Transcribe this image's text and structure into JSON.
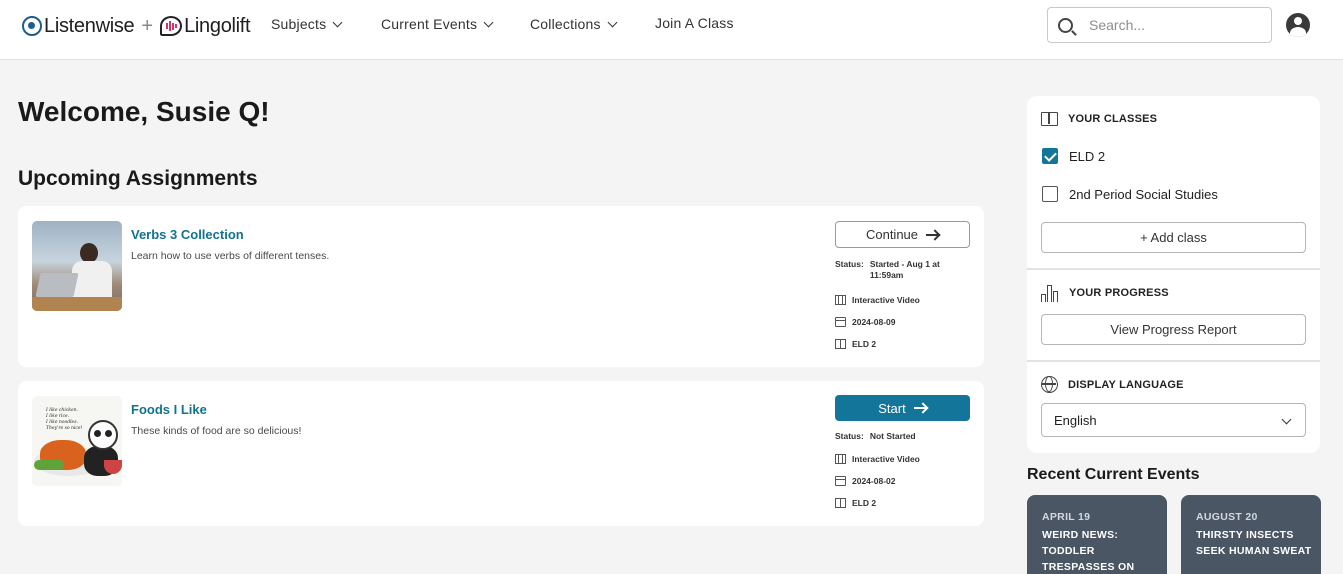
{
  "header": {
    "logo_primary": "Listenwise",
    "logo_plus": "+",
    "logo_secondary": "Lingolift",
    "nav": [
      {
        "label": "Subjects"
      },
      {
        "label": "Current Events"
      },
      {
        "label": "Collections"
      },
      {
        "label": "Join A Class"
      }
    ],
    "search_placeholder": "Search..."
  },
  "main": {
    "welcome": "Welcome, Susie Q!",
    "section_title": "Upcoming Assignments",
    "assignments": [
      {
        "title": "Verbs 3 Collection",
        "description": "Learn how to use verbs of different tenses.",
        "button": "Continue",
        "status_label": "Status:",
        "status_value": "Started - Aug 1 at 11:59am",
        "type": "Interactive Video",
        "date": "2024-08-09",
        "class": "ELD 2"
      },
      {
        "title": "Foods I Like",
        "description": "These kinds of food are so delicious!",
        "button": "Start",
        "status_label": "Status:",
        "status_value": "Not Started",
        "type": "Interactive Video",
        "date": "2024-08-02",
        "class": "ELD 2",
        "thumb_text": [
          "I like chicken.",
          "I like rice.",
          "I like noodles.",
          "They're so nice!"
        ]
      }
    ]
  },
  "sidebar": {
    "classes_heading": "YOUR CLASSES",
    "classes": [
      {
        "label": "ELD 2",
        "checked": true
      },
      {
        "label": "2nd Period Social Studies",
        "checked": false
      }
    ],
    "add_class": "+ Add class",
    "progress_heading": "YOUR PROGRESS",
    "progress_button": "View Progress Report",
    "language_heading": "DISPLAY LANGUAGE",
    "language_value": "English"
  },
  "recent": {
    "title": "Recent Current Events",
    "items": [
      {
        "date": "APRIL 19",
        "headline": "WEIRD NEWS: TODDLER TRESPASSES ON"
      },
      {
        "date": "AUGUST 20",
        "headline": "THIRSTY INSECTS SEEK HUMAN SWEAT"
      }
    ]
  },
  "colors": {
    "accent": "#137599",
    "link": "#12738f",
    "news_card": "#4a5663"
  }
}
